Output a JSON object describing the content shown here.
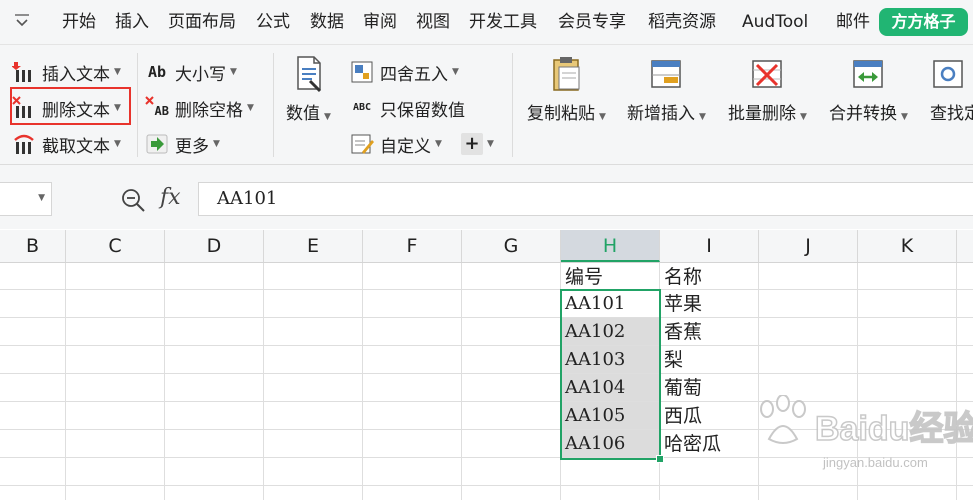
{
  "menu": {
    "items": [
      "开始",
      "插入",
      "页面布局",
      "公式",
      "数据",
      "审阅",
      "视图",
      "开发工具",
      "会员专享",
      "稻壳资源",
      "AudTool",
      "邮件"
    ],
    "special": "方方格子"
  },
  "ribbon": {
    "text_group": {
      "insert_text": "插入文本",
      "delete_text": "删除文本",
      "extract_text": "截取文本"
    },
    "case_group": {
      "case": "大小写",
      "delete_spaces": "删除空格",
      "more": "更多"
    },
    "number": {
      "label": "数值"
    },
    "round_group": {
      "round": "四舍五入",
      "keep_numbers": "只保留数值",
      "custom": "自定义"
    },
    "big_buttons": {
      "copy_paste": "复制粘贴",
      "add_insert": "新增插入",
      "batch_delete": "批量删除",
      "merge_convert": "合并转换",
      "find": "查找定"
    },
    "icon_texts": {
      "case_ab": "Ab",
      "spaces_ab": "AB",
      "keep_abc": "ABC"
    }
  },
  "formula_bar": {
    "value": "AA101",
    "fx": "fx"
  },
  "columns": [
    "B",
    "C",
    "D",
    "E",
    "F",
    "G",
    "H",
    "I",
    "J",
    "K"
  ],
  "active_column": "H",
  "table": {
    "headers": [
      "编号",
      "名称"
    ],
    "rows": [
      [
        "AA101",
        "苹果"
      ],
      [
        "AA102",
        "香蕉"
      ],
      [
        "AA103",
        "梨"
      ],
      [
        "AA104",
        "葡萄"
      ],
      [
        "AA105",
        "西瓜"
      ],
      [
        "AA106",
        "哈密瓜"
      ]
    ]
  },
  "watermark": {
    "text": "Baidu经验",
    "sub": "jingyan.baidu.com"
  },
  "colors": {
    "accent": "#21a366",
    "highlight": "#e8332c",
    "special_tab": "#21b573"
  }
}
